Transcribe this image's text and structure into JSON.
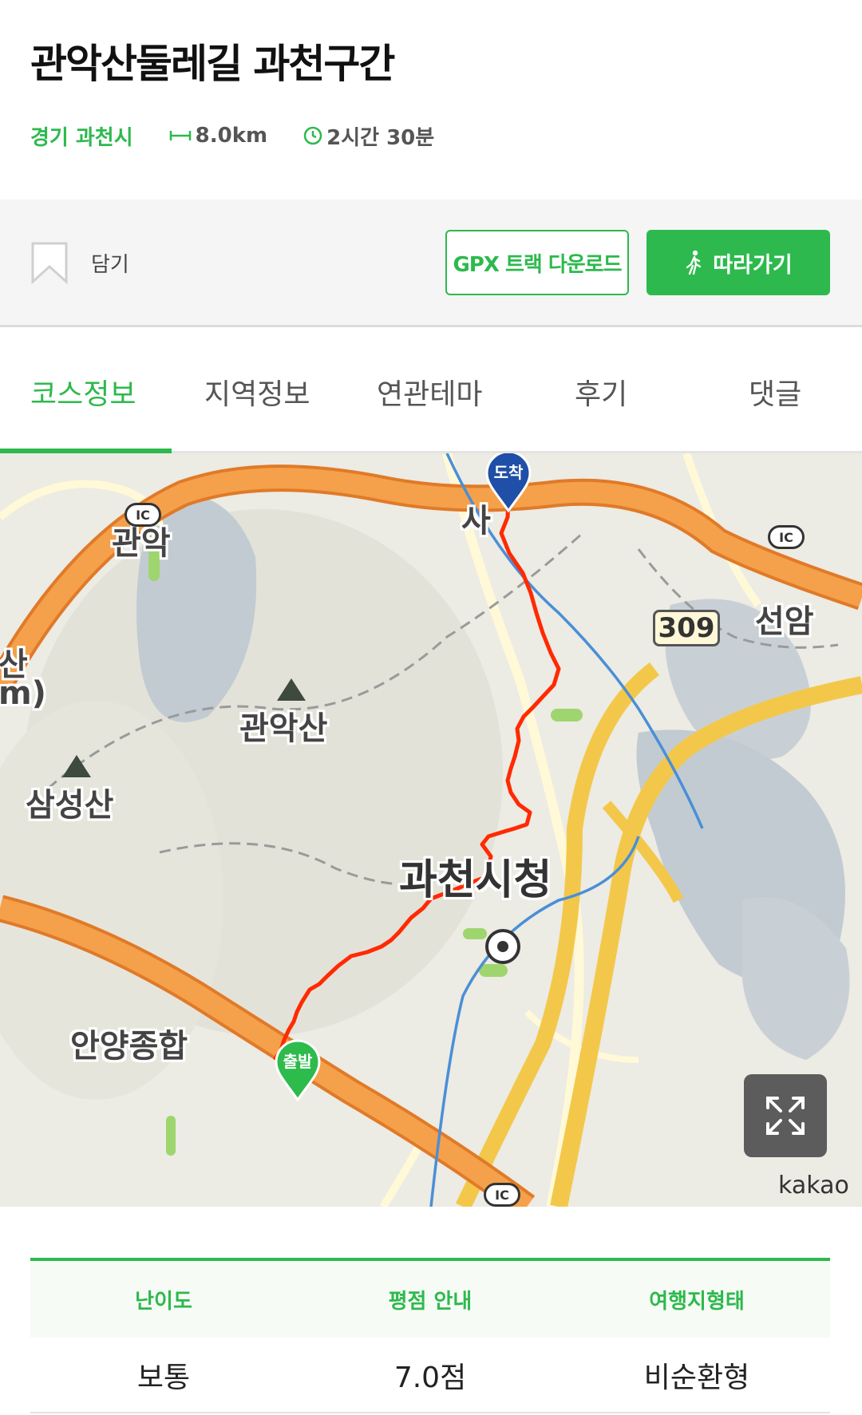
{
  "course": {
    "title": "관악산둘레길 과천구간",
    "region": "경기 과천시",
    "distance": "8.0km",
    "duration": "2시간 30분"
  },
  "actions": {
    "bookmark_label": "담기",
    "gpx_button": "GPX 트랙 다운로드",
    "follow_button": "따라가기"
  },
  "tabs": [
    {
      "label": "코스정보",
      "active": true
    },
    {
      "label": "지역정보",
      "active": false
    },
    {
      "label": "연관테마",
      "active": false
    },
    {
      "label": "후기",
      "active": false
    },
    {
      "label": "댓글",
      "active": false
    }
  ],
  "map": {
    "labels": {
      "gwanak": "관악",
      "seonam": "선암",
      "gwanaksan": "관악산",
      "samseongsan": "삼성산",
      "gwacheon_cityhall": "과천시청",
      "anyang": "안양종합",
      "san_partial": "산",
      "m_partial": "m)",
      "sa_partial": "사"
    },
    "road_number": "309",
    "ic_label": "IC",
    "pin_end": "도착",
    "pin_start": "출발",
    "attribution": "kakao"
  },
  "info_table": {
    "headers": [
      "난이도",
      "평점 안내",
      "여행지형태"
    ],
    "values": [
      "보통",
      "7.0점",
      "비순환형"
    ]
  },
  "colors": {
    "accent": "#2db94d",
    "route": "#ff2a00",
    "highway": "#f5a04a",
    "end_pin": "#1f4fa6",
    "start_pin": "#2dbb4c"
  }
}
